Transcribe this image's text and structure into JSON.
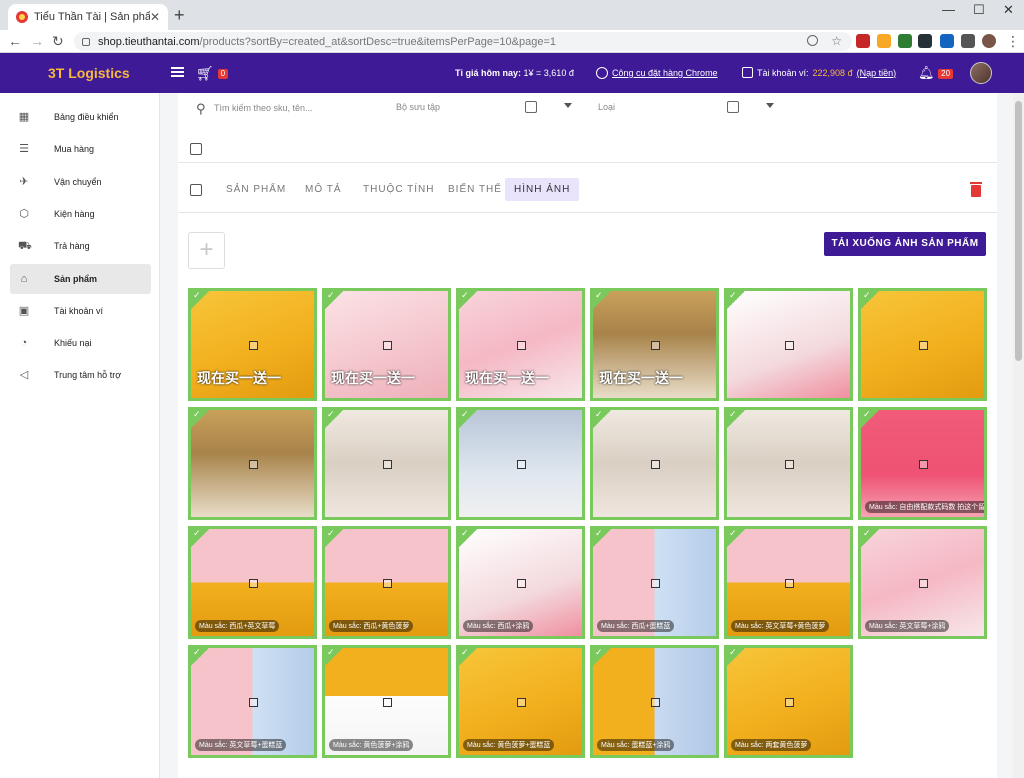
{
  "browser": {
    "tab_title": "Tiểu Thần Tài | Sản phẩm",
    "url_host": "shop.tieuthantai.com",
    "url_path": "/products?sortBy=created_at&sortDesc=true&itemsPerPage=10&page=1"
  },
  "header": {
    "logo": "3T Logistics",
    "cart_count": "0",
    "rate_label": "Tỉ giá hôm nay:",
    "rate_value": "1¥ = 3,610 đ",
    "chrome_tool": "Công cụ đặt hàng Chrome",
    "wallet_label": "Tài khoản ví:",
    "wallet_amount": "222,908 đ",
    "wallet_topup": "(Nạp tiền)",
    "notif_count": "20"
  },
  "sidebar": {
    "items": [
      {
        "label": "Bảng điều khiển",
        "icon": "dashboard-icon"
      },
      {
        "label": "Mua hàng",
        "icon": "list-icon"
      },
      {
        "label": "Vận chuyển",
        "icon": "airplane-icon"
      },
      {
        "label": "Kiện hàng",
        "icon": "box-icon"
      },
      {
        "label": "Trả hàng",
        "icon": "truck-icon"
      },
      {
        "label": "Sản phẩm",
        "icon": "store-icon",
        "active": true
      },
      {
        "label": "Tài khoản ví",
        "icon": "wallet-icon"
      },
      {
        "label": "Khiếu nại",
        "icon": "messenger-icon"
      },
      {
        "label": "Trung tâm hỗ trợ",
        "icon": "megaphone-icon"
      }
    ]
  },
  "filters": {
    "search_placeholder": "Tìm kiếm theo sku, tên...",
    "collection_label": "Bộ sưu tập",
    "type_label": "Loại"
  },
  "product_tabs": [
    "SẢN PHẨM",
    "MÔ TẢ",
    "THUỘC TÍNH",
    "BIẾN THỂ",
    "HÌNH ẢNH"
  ],
  "active_tab": "HÌNH ẢNH",
  "download_button": "TẢI XUỐNG ẢNH SẢN PHẨM",
  "add_symbol": "+",
  "images": [
    {
      "style": "p-yellow",
      "caption": "",
      "overlay": "现在买一送一"
    },
    {
      "style": "p-pink",
      "caption": "",
      "overlay": "现在买一送一"
    },
    {
      "style": "p-pink2",
      "caption": "",
      "overlay": "现在买一送一"
    },
    {
      "style": "p-model",
      "caption": "",
      "overlay": "现在买一送一"
    },
    {
      "style": "p-white",
      "caption": "",
      "overlay": ""
    },
    {
      "style": "p-yellow",
      "caption": "",
      "overlay": ""
    },
    {
      "style": "p-model",
      "caption": "",
      "overlay": ""
    },
    {
      "style": "p-room",
      "caption": "",
      "overlay": ""
    },
    {
      "style": "p-room2",
      "caption": "",
      "overlay": ""
    },
    {
      "style": "p-room",
      "caption": "",
      "overlay": ""
    },
    {
      "style": "p-room",
      "caption": "",
      "overlay": ""
    },
    {
      "style": "p-promo",
      "caption": "Màu sắc: 自由搭配款式码数 拍这个留言",
      "overlay": ""
    },
    {
      "style": "p-mixyp",
      "caption": "Màu sắc: 西瓜+英文草莓",
      "overlay": ""
    },
    {
      "style": "p-mixyp",
      "caption": "Màu sắc: 西瓜+黄色菠萝",
      "overlay": ""
    },
    {
      "style": "p-white",
      "caption": "Màu sắc: 西瓜+涂鸦",
      "overlay": ""
    },
    {
      "style": "p-mixbw",
      "caption": "Màu sắc: 西瓜+蛋糕蓝",
      "overlay": ""
    },
    {
      "style": "p-mixyp",
      "caption": "Màu sắc: 英文草莓+黄色菠萝",
      "overlay": ""
    },
    {
      "style": "p-pink2",
      "caption": "Màu sắc: 英文草莓+涂鸦",
      "overlay": ""
    },
    {
      "style": "p-mixbw",
      "caption": "Màu sắc: 英文草莓+蛋糕蓝",
      "overlay": ""
    },
    {
      "style": "p-mixwy",
      "caption": "Màu sắc: 黄色菠萝+涂鸦",
      "overlay": ""
    },
    {
      "style": "p-yellow",
      "caption": "Màu sắc: 黄色菠萝+蛋糕蓝",
      "overlay": ""
    },
    {
      "style": "p-mixyb",
      "caption": "Màu sắc: 蛋糕蓝+涂鸦",
      "overlay": ""
    },
    {
      "style": "p-yellow",
      "caption": "Màu sắc: 两套黄色菠萝",
      "overlay": ""
    }
  ],
  "colors": {
    "brand": "#3f1a96",
    "logo": "#f6b93b",
    "selected_border": "#7ac95c",
    "danger": "#e53935",
    "active_tab_bg": "#e9e3fb"
  }
}
